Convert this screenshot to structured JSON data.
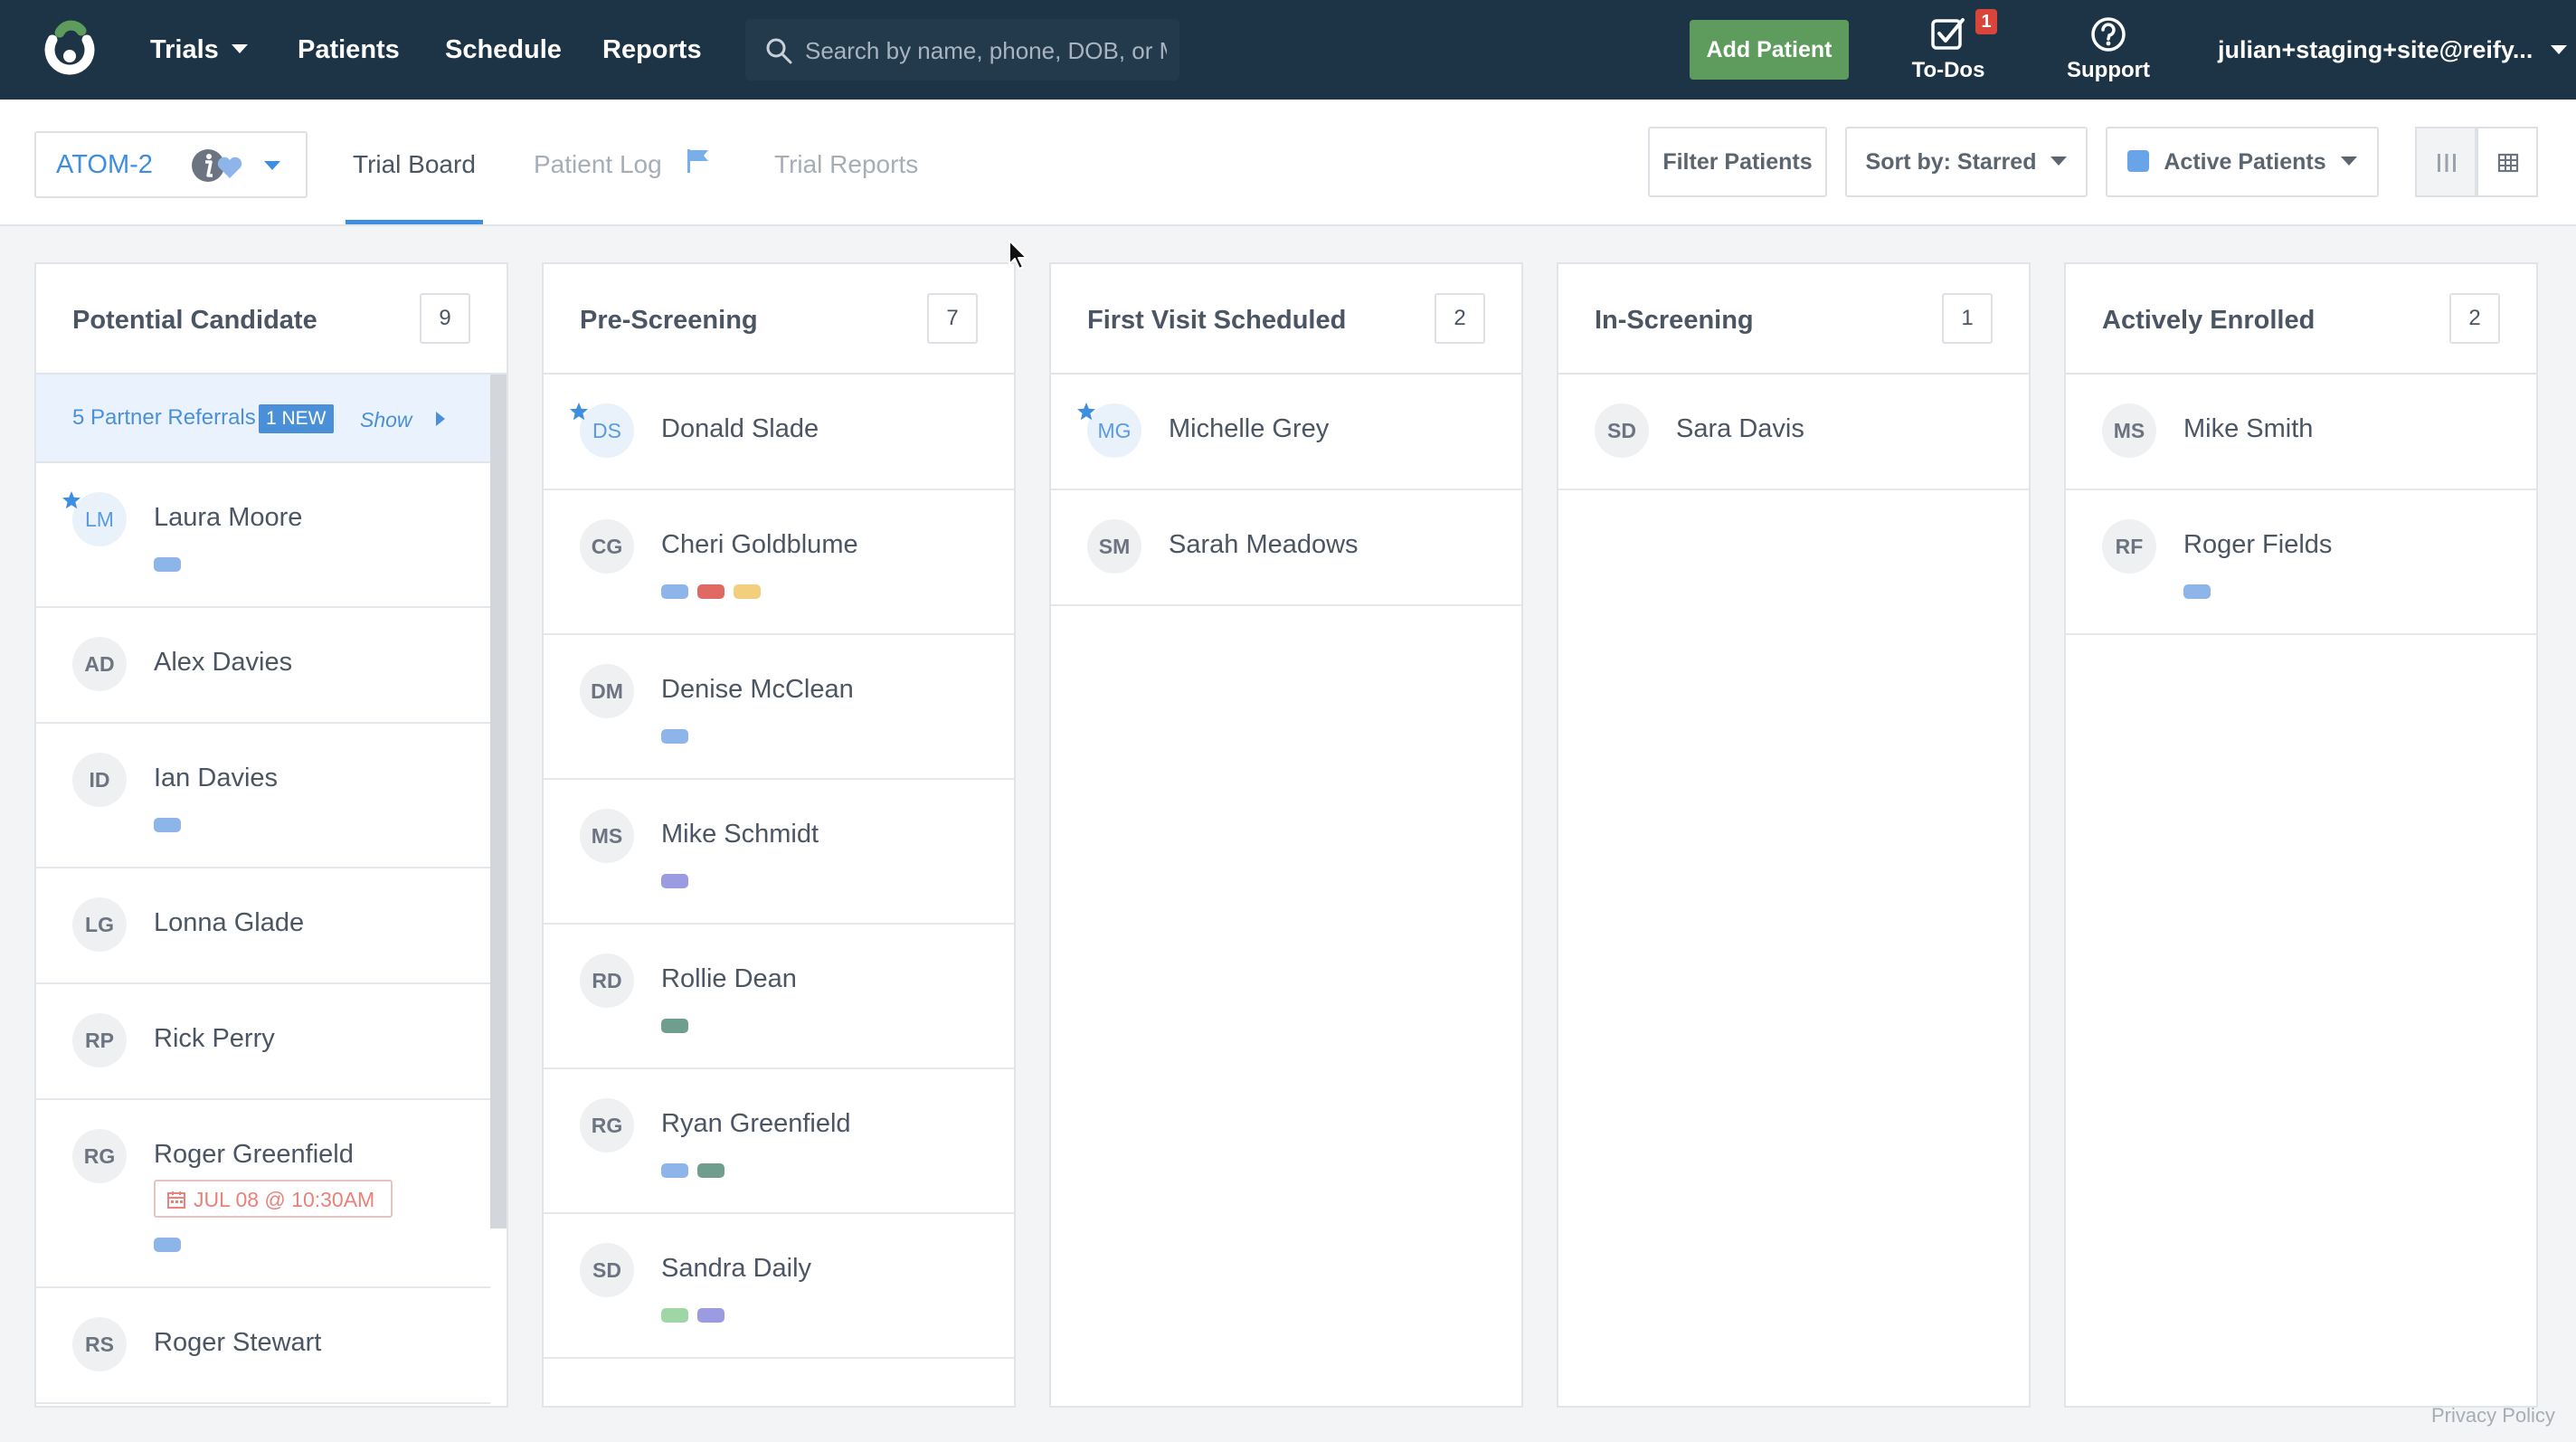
{
  "nav": {
    "trials_label": "Trials",
    "patients_label": "Patients",
    "schedule_label": "Schedule",
    "reports_label": "Reports",
    "search_placeholder": "Search by name, phone, DOB, or MRN",
    "add_patient_label": "Add Patient",
    "todos_label": "To-Dos",
    "todos_count": "1",
    "support_label": "Support",
    "user_label": "julian+staging+site@reify..."
  },
  "subheader": {
    "trial_name": "ATOM-2",
    "tabs": [
      "Trial Board",
      "Patient Log",
      "Trial Reports"
    ],
    "filter_label": "Filter Patients",
    "sort_label": "Sort by: Starred",
    "active_patients_label": "Active Patients"
  },
  "colors": {
    "blue": "#8db5ea",
    "red": "#e06a63",
    "yellow": "#f3cf7d",
    "purple": "#9b9be2",
    "teal": "#6f9e8f",
    "green": "#9fd6a6",
    "accent": "#3d8ee0",
    "nav_bg": "#1d3446"
  },
  "columns": [
    {
      "title": "Potential Candidate",
      "count": "9",
      "referral": {
        "text": "5 Partner Referrals",
        "badge": "1 NEW",
        "show": "Show"
      },
      "patients": [
        {
          "initials": "LM",
          "name": "Laura Moore",
          "starred": true,
          "tags": [
            "blue"
          ]
        },
        {
          "initials": "AD",
          "name": "Alex Davies",
          "starred": false,
          "tags": []
        },
        {
          "initials": "ID",
          "name": "Ian Davies",
          "starred": false,
          "tags": [
            "blue"
          ]
        },
        {
          "initials": "LG",
          "name": "Lonna Glade",
          "starred": false,
          "tags": []
        },
        {
          "initials": "RP",
          "name": "Rick Perry",
          "starred": false,
          "tags": []
        },
        {
          "initials": "RG",
          "name": "Roger Greenfield",
          "starred": false,
          "tags": [
            "blue"
          ],
          "appointment": "JUL 08 @ 10:30AM"
        },
        {
          "initials": "RS",
          "name": "Roger Stewart",
          "starred": false,
          "tags": []
        }
      ]
    },
    {
      "title": "Pre-Screening",
      "count": "7",
      "patients": [
        {
          "initials": "DS",
          "name": "Donald Slade",
          "starred": true,
          "tags": []
        },
        {
          "initials": "CG",
          "name": "Cheri Goldblume",
          "starred": false,
          "tags": [
            "blue",
            "red",
            "yellow"
          ]
        },
        {
          "initials": "DM",
          "name": "Denise McClean",
          "starred": false,
          "tags": [
            "blue"
          ]
        },
        {
          "initials": "MS",
          "name": "Mike Schmidt",
          "starred": false,
          "tags": [
            "purple"
          ]
        },
        {
          "initials": "RD",
          "name": "Rollie Dean",
          "starred": false,
          "tags": [
            "teal"
          ]
        },
        {
          "initials": "RG",
          "name": "Ryan Greenfield",
          "starred": false,
          "tags": [
            "blue",
            "teal"
          ]
        },
        {
          "initials": "SD",
          "name": "Sandra Daily",
          "starred": false,
          "tags": [
            "green",
            "purple"
          ]
        }
      ]
    },
    {
      "title": "First Visit Scheduled",
      "count": "2",
      "patients": [
        {
          "initials": "MG",
          "name": "Michelle Grey",
          "starred": true,
          "tags": []
        },
        {
          "initials": "SM",
          "name": "Sarah Meadows",
          "starred": false,
          "tags": []
        }
      ]
    },
    {
      "title": "In-Screening",
      "count": "1",
      "patients": [
        {
          "initials": "SD",
          "name": "Sara Davis",
          "starred": false,
          "tags": []
        }
      ]
    },
    {
      "title": "Actively Enrolled",
      "count": "2",
      "patients": [
        {
          "initials": "MS",
          "name": "Mike Smith",
          "starred": false,
          "tags": []
        },
        {
          "initials": "RF",
          "name": "Roger Fields",
          "starred": false,
          "tags": [
            "blue"
          ]
        }
      ]
    }
  ],
  "footer": {
    "privacy_label": "Privacy Policy"
  }
}
